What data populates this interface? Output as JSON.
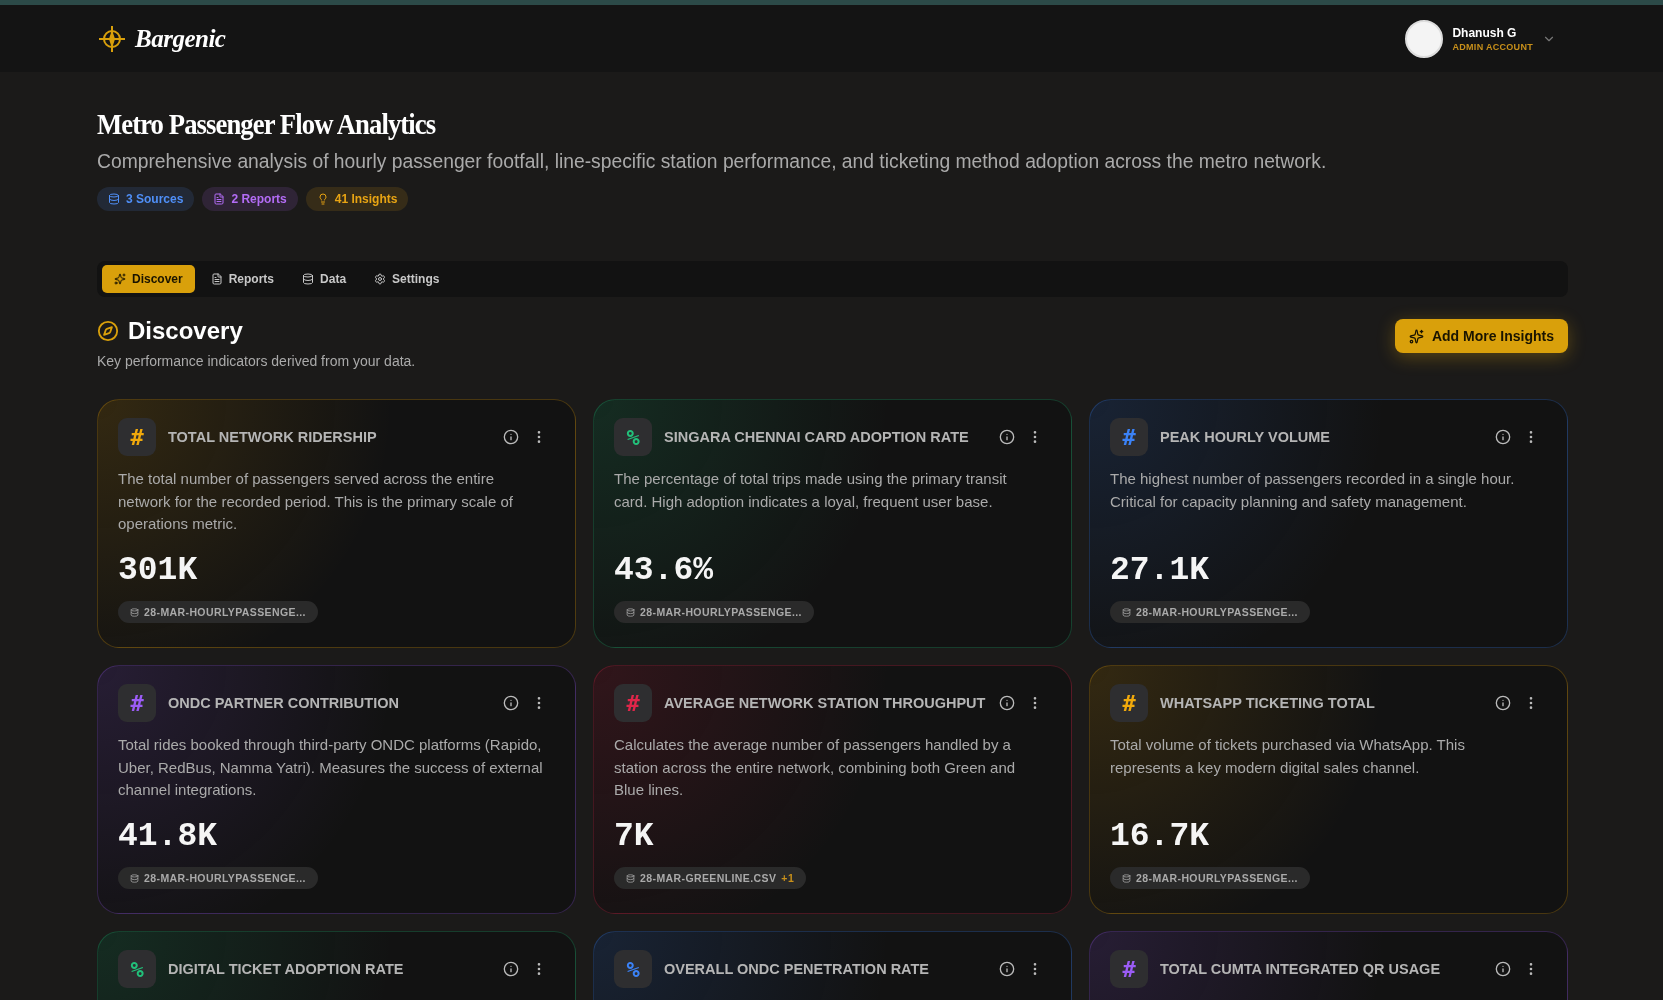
{
  "header": {
    "brand": "Bargenic",
    "user": {
      "name": "Dhanush G",
      "role": "ADMIN ACCOUNT"
    }
  },
  "page": {
    "title": "Metro Passenger Flow Analytics",
    "subtitle": "Comprehensive analysis of hourly passenger footfall, line-specific station performance, and ticketing method adoption across the metro network.",
    "badges": [
      {
        "kind": "sources",
        "label": "3 Sources",
        "color": "#4f8ff7"
      },
      {
        "kind": "reports",
        "label": "2 Reports",
        "color": "#b36cf5"
      },
      {
        "kind": "insights",
        "label": "41 Insights",
        "color": "#e8a413"
      }
    ]
  },
  "tabs": [
    {
      "kind": "discover",
      "label": "Discover",
      "selected": true
    },
    {
      "kind": "reports",
      "label": "Reports",
      "selected": false
    },
    {
      "kind": "data",
      "label": "Data",
      "selected": false
    },
    {
      "kind": "settings",
      "label": "Settings",
      "selected": false
    }
  ],
  "section": {
    "title": "Discovery",
    "subtitle": "Key performance indicators derived from your data.",
    "action": "Add More Insights"
  },
  "cards": [
    {
      "symbol": "#",
      "color": "#f0a90c",
      "title": "TOTAL NETWORK RIDERSHIP",
      "description": "The total number of passengers served across the entire network for the recorded period. This is the primary scale of operations metric.",
      "value": "301K",
      "source": "28-MAR-HOURLYPASSENGE..."
    },
    {
      "symbol": "%",
      "color": "#22c07a",
      "title": "SINGARA CHENNAI CARD ADOPTION RATE",
      "description": "The percentage of total trips made using the primary transit card. High adoption indicates a loyal, frequent user base.",
      "value": "43.6%",
      "source": "28-MAR-HOURLYPASSENGE..."
    },
    {
      "symbol": "#",
      "color": "#3b82f6",
      "title": "PEAK HOURLY VOLUME",
      "description": "The highest number of passengers recorded in a single hour. Critical for capacity planning and safety management.",
      "value": "27.1K",
      "source": "28-MAR-HOURLYPASSENGE..."
    },
    {
      "symbol": "#",
      "color": "#9b5cf6",
      "title": "ONDC PARTNER CONTRIBUTION",
      "description": "Total rides booked through third-party ONDC platforms (Rapido, Uber, RedBus, Namma Yatri). Measures the success of external channel integrations.",
      "value": "41.8K",
      "source": "28-MAR-HOURLYPASSENGE..."
    },
    {
      "symbol": "#",
      "color": "#e0264a",
      "title": "AVERAGE NETWORK STATION THROUGHPUT",
      "description": "Calculates the average number of passengers handled by a station across the entire network, combining both Green and Blue lines.",
      "value": "7K",
      "source": "28-MAR-GREENLINE.CSV",
      "extra": "+1"
    },
    {
      "symbol": "#",
      "color": "#f0a90c",
      "title": "WHATSAPP TICKETING TOTAL",
      "description": "Total volume of tickets purchased via WhatsApp. This represents a key modern digital sales channel.",
      "value": "16.7K",
      "source": "28-MAR-HOURLYPASSENGE..."
    },
    {
      "symbol": "%",
      "color": "#22c07a",
      "title": "DIGITAL TICKET ADOPTION RATE"
    },
    {
      "symbol": "%",
      "color": "#3b82f6",
      "title": "OVERALL ONDC PENETRATION RATE"
    },
    {
      "symbol": "#",
      "color": "#9b5cf6",
      "title": "TOTAL CUMTA INTEGRATED QR USAGE"
    }
  ]
}
